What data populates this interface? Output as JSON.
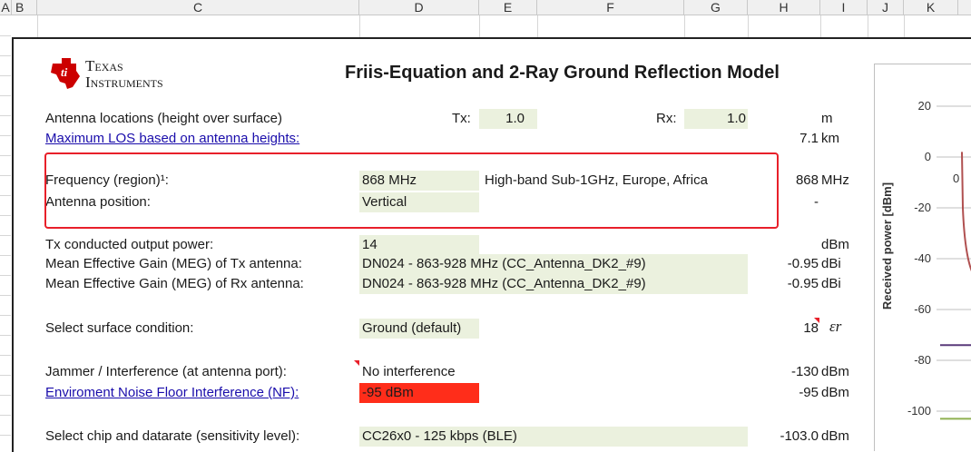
{
  "columns": [
    "A",
    "B",
    "C",
    "D",
    "E",
    "F",
    "G",
    "H",
    "I",
    "J",
    "K"
  ],
  "header": {
    "logo_line1": "Texas",
    "logo_line2": "Instruments",
    "title": "Friis-Equation and 2-Ray Ground Reflection Model"
  },
  "antenna": {
    "label": "Antenna locations (height over surface)",
    "tx_label": "Tx:",
    "tx_value": "1.0",
    "rx_label": "Rx:",
    "rx_value": "1.0",
    "unit": "m"
  },
  "max_los": {
    "label": "Maximum LOS based on antenna heights:",
    "value": "7.1",
    "unit": "km"
  },
  "frequency": {
    "label": "Frequency (region)¹:",
    "value": "868 MHz",
    "region": "High-band Sub-1GHz, Europe, Africa",
    "result": "868",
    "unit": "MHz"
  },
  "position": {
    "label": "Antenna position:",
    "value": "Vertical",
    "result": "-"
  },
  "tx_power": {
    "label": "Tx conducted output power:",
    "value": "14",
    "unit": "dBm"
  },
  "meg_tx": {
    "label": "Mean Effective Gain (MEG) of Tx antenna:",
    "value": "DN024 - 863-928 MHz (CC_Antenna_DK2_#9)",
    "result": "-0.95",
    "unit": "dBi"
  },
  "meg_rx": {
    "label": "Mean Effective Gain (MEG) of Rx antenna:",
    "value": "DN024 - 863-928 MHz (CC_Antenna_DK2_#9)",
    "result": "-0.95",
    "unit": "dBi"
  },
  "surface": {
    "label": "Select surface condition:",
    "value": "Ground (default)",
    "result": "18",
    "unit": "εr"
  },
  "jammer": {
    "label": "Jammer / Interference (at antenna port):",
    "value": "No interference",
    "result": "-130",
    "unit": "dBm"
  },
  "noise_floor": {
    "label": "Enviroment Noise Floor Interference (NF):",
    "value": "-95 dBm",
    "result": "-95",
    "unit": "dBm"
  },
  "chip": {
    "label": "Select chip and datarate (sensitivity level):",
    "value": "CC26x0 - 125 kbps (BLE)",
    "result": "-103.0",
    "unit": "dBm"
  },
  "colors": {
    "input_fill": "#ebf1de",
    "noise_fill": "#ff2d1a",
    "highlight_border": "#e8202a",
    "link": "#1a0dab",
    "series_main": "#b05050",
    "series_purple": "#5a3a7a",
    "series_green": "#8fb050"
  },
  "chart_data": {
    "type": "line",
    "ylabel": "Received power [dBm]",
    "yticks": [
      "20",
      "0",
      "-20",
      "-40",
      "-60",
      "-80",
      "-100"
    ],
    "ylim": [
      -120,
      20
    ],
    "x_first_label": "0",
    "series": [
      {
        "values": [
          2,
          -20,
          -35,
          -45
        ]
      },
      {
        "values": [
          -74,
          -74
        ]
      },
      {
        "values": [
          -103,
          -103
        ]
      }
    ]
  }
}
